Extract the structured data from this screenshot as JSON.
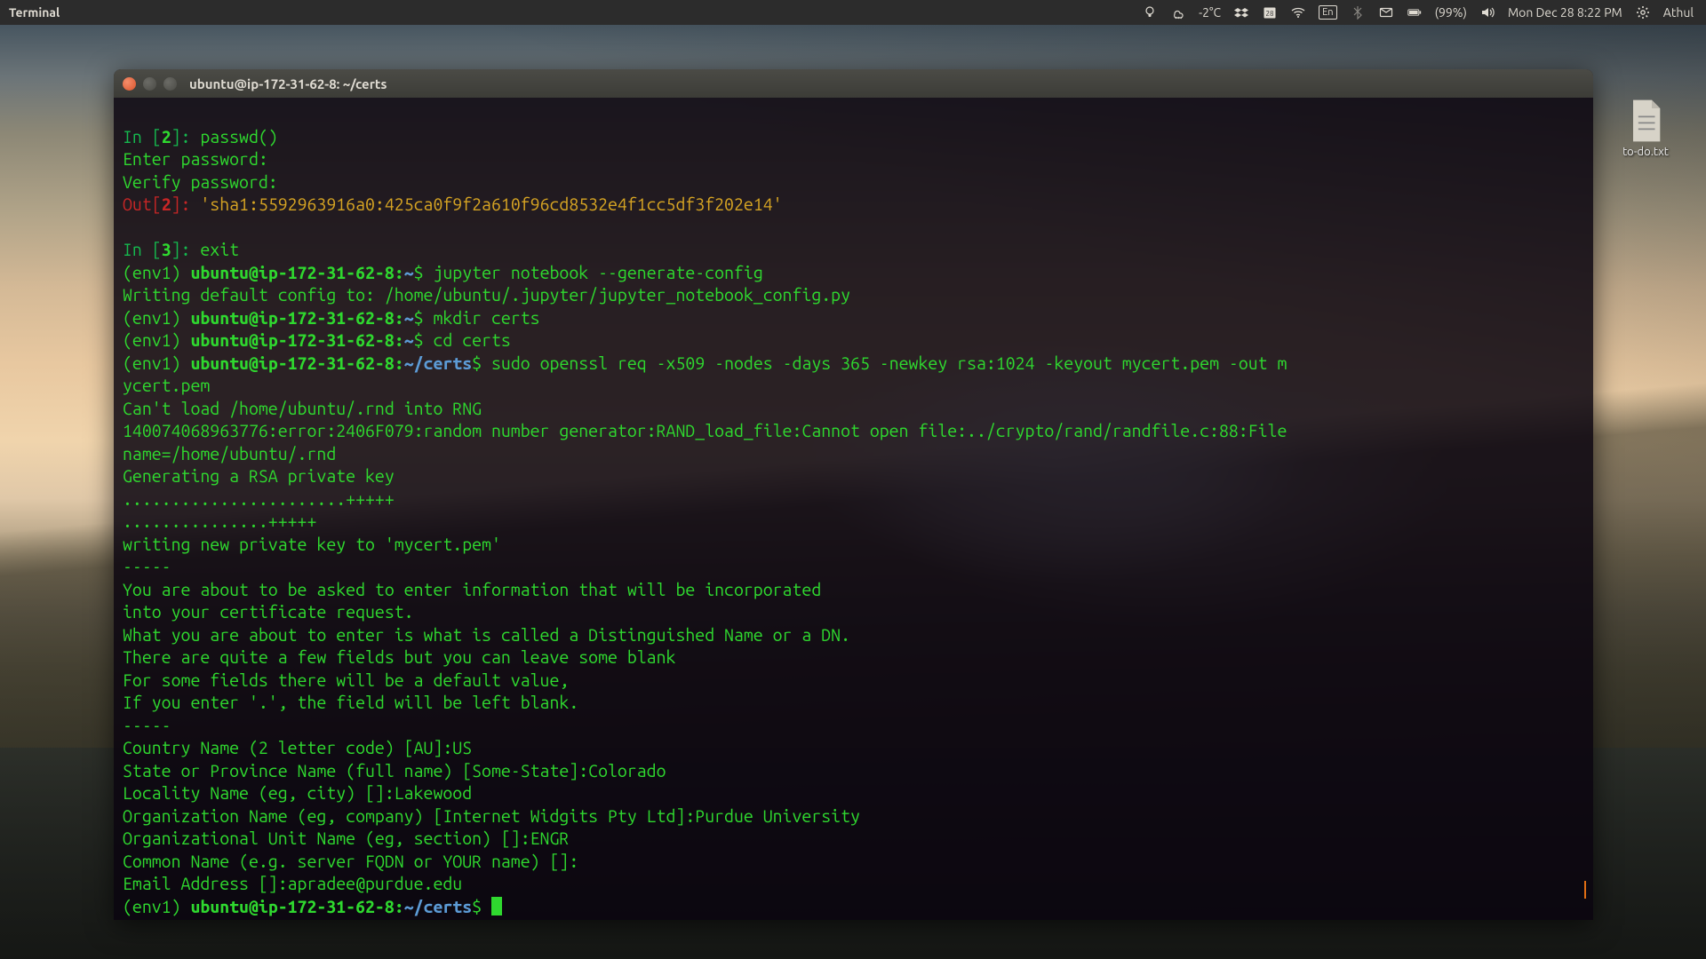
{
  "panel": {
    "app_title": "Terminal",
    "temp": "-2°C",
    "lang": "En",
    "calendar_day": "28",
    "battery": "(99%)",
    "datetime": "Mon Dec 28  8:22 PM",
    "user": "Athul"
  },
  "desktop": {
    "file_label": "to-do.txt"
  },
  "terminal": {
    "title": "ubuntu@ip-172-31-62-8: ~/certs",
    "in2_num": "2",
    "in2_cmd": "passwd()",
    "enter_pw": "Enter password: ",
    "verify_pw": "Verify password: ",
    "out2_num": "2",
    "sha": "'sha1:5592963916a0:425ca0f9f2a610f96cd8532e4f1cc5df3f202e14'",
    "in3_num": "3",
    "in3_cmd": "exit",
    "prompt_env": "(env1) ",
    "userhost": "ubuntu@ip-172-31-62-8",
    "home": "~",
    "certs": "~/certs",
    "cmd_genconfig": "jupyter notebook --generate-config",
    "out_config": "Writing default config to: /home/ubuntu/.jupyter/jupyter_notebook_config.py",
    "cmd_mkdir": "mkdir certs",
    "cmd_cd": "cd certs",
    "cmd_openssl1": "sudo openssl req -x509 -nodes -days 365 -newkey rsa:1024 -keyout mycert.pem -out m",
    "cmd_openssl2": "ycert.pem",
    "e1": "Can't load /home/ubuntu/.rnd into RNG",
    "e2": "140074068963776:error:2406F079:random number generator:RAND_load_file:Cannot open file:../crypto/rand/randfile.c:88:File",
    "e3": "name=/home/ubuntu/.rnd",
    "g1": "Generating a RSA private key",
    "g2": ".......................+++++",
    "g3": "...............+++++",
    "g4": "writing new private key to 'mycert.pem'",
    "dash": "-----",
    "p1": "You are about to be asked to enter information that will be incorporated",
    "p2": "into your certificate request.",
    "p3": "What you are about to enter is what is called a Distinguished Name or a DN.",
    "p4": "There are quite a few fields but you can leave some blank",
    "p5": "For some fields there will be a default value,",
    "p6": "If you enter '.', the field will be left blank.",
    "q1": "Country Name (2 letter code) [AU]:US",
    "q2": "State or Province Name (full name) [Some-State]:Colorado",
    "q3": "Locality Name (eg, city) []:Lakewood",
    "q4": "Organization Name (eg, company) [Internet Widgits Pty Ltd]:Purdue University",
    "q5": "Organizational Unit Name (eg, section) []:ENGR",
    "q6": "Common Name (e.g. server FQDN or YOUR name) []:",
    "q7": "Email Address []:apradee@purdue.edu"
  }
}
